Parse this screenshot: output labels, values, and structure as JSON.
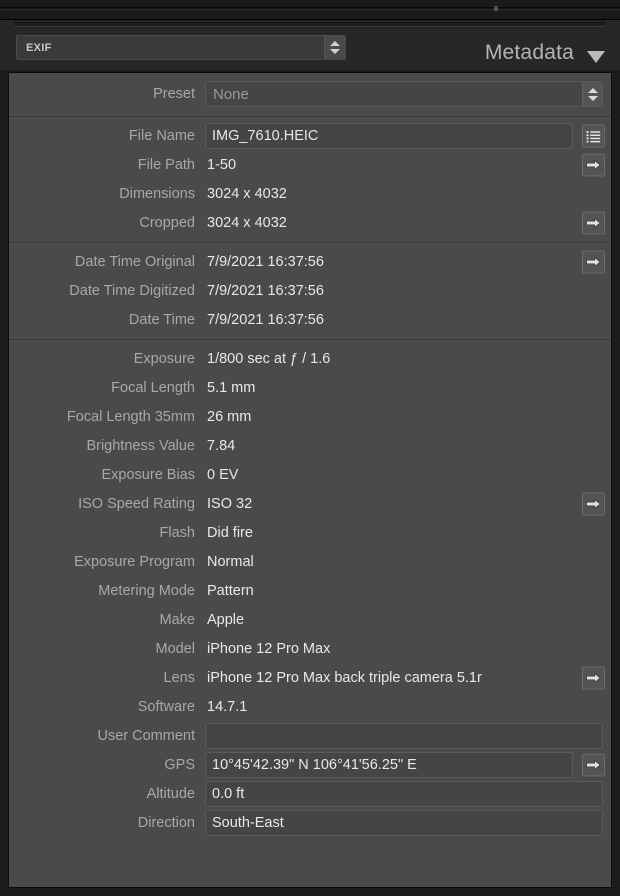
{
  "window": {
    "top_strip": ""
  },
  "header": {
    "selector_value": "EXIF",
    "selector_icon": "stepper-updown-icon",
    "title": "Metadata",
    "collapse_icon": "triangle-down-icon"
  },
  "preset": {
    "label": "Preset",
    "value": "None",
    "stepper_icon": "stepper-updown-icon"
  },
  "groups": [
    {
      "rows": [
        {
          "label": "File Name",
          "value": "IMG_7610.HEIC",
          "field": true,
          "action": "list-icon"
        },
        {
          "label": "File Path",
          "value": "1-50",
          "field": false,
          "action": "arrow-right-icon"
        },
        {
          "label": "Dimensions",
          "value": "3024 x 4032",
          "field": false,
          "action": null
        },
        {
          "label": "Cropped",
          "value": "3024 x 4032",
          "field": false,
          "action": "arrow-right-icon"
        }
      ]
    },
    {
      "rows": [
        {
          "label": "Date Time Original",
          "value": "7/9/2021 16:37:56",
          "field": false,
          "action": "arrow-right-icon"
        },
        {
          "label": "Date Time Digitized",
          "value": "7/9/2021 16:37:56",
          "field": false,
          "action": null
        },
        {
          "label": "Date Time",
          "value": "7/9/2021 16:37:56",
          "field": false,
          "action": null
        }
      ]
    },
    {
      "rows": [
        {
          "label": "Exposure",
          "value": "1/800 sec at ƒ / 1.6",
          "field": false,
          "action": null
        },
        {
          "label": "Focal Length",
          "value": "5.1 mm",
          "field": false,
          "action": null
        },
        {
          "label": "Focal Length 35mm",
          "value": "26 mm",
          "field": false,
          "action": null
        },
        {
          "label": "Brightness Value",
          "value": "7.84",
          "field": false,
          "action": null
        },
        {
          "label": "Exposure Bias",
          "value": "0 EV",
          "field": false,
          "action": null
        },
        {
          "label": "ISO Speed Rating",
          "value": "ISO 32",
          "field": false,
          "action": "arrow-right-icon"
        },
        {
          "label": "Flash",
          "value": "Did fire",
          "field": false,
          "action": null
        },
        {
          "label": "Exposure Program",
          "value": "Normal",
          "field": false,
          "action": null
        },
        {
          "label": "Metering Mode",
          "value": "Pattern",
          "field": false,
          "action": null
        },
        {
          "label": "Make",
          "value": "Apple",
          "field": false,
          "action": null
        },
        {
          "label": "Model",
          "value": "iPhone 12 Pro Max",
          "field": false,
          "action": null
        },
        {
          "label": "Lens",
          "value": "iPhone 12 Pro Max back triple camera 5.1r",
          "field": false,
          "action": "arrow-right-icon"
        },
        {
          "label": "Software",
          "value": "14.7.1",
          "field": false,
          "action": null
        },
        {
          "label": "User Comment",
          "value": "",
          "field": true,
          "action": null
        },
        {
          "label": "GPS",
          "value": "10°45'42.39\" N 106°41'56.25\" E",
          "field": true,
          "action": "arrow-right-icon"
        },
        {
          "label": "Altitude",
          "value": "0.0 ft",
          "field": true,
          "action": null
        },
        {
          "label": "Direction",
          "value": "South-East",
          "field": true,
          "action": null
        }
      ]
    }
  ],
  "colors": {
    "panel_bg": "#4a4a4a",
    "header_bg": "#272727",
    "label_text": "#a8a8a8",
    "value_text": "#e8e8e8",
    "field_bg": "#454545",
    "field_border": "#5a5a5a"
  }
}
